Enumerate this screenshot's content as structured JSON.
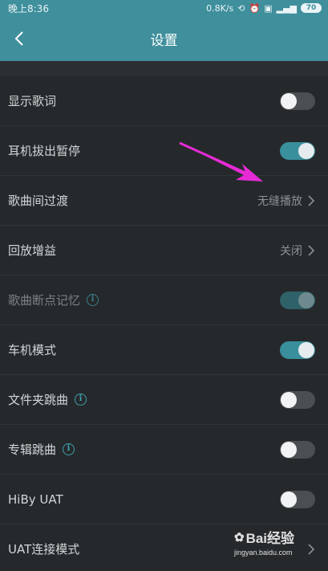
{
  "status_bar": {
    "time": "晚上8:36",
    "network_speed": "0.8K/s",
    "battery": "70"
  },
  "header": {
    "title": "设置"
  },
  "settings": [
    {
      "label": "显示歌词",
      "control": "toggle",
      "state": "off"
    },
    {
      "label": "耳机拔出暂停",
      "control": "toggle",
      "state": "on"
    },
    {
      "label": "歌曲间过渡",
      "control": "value",
      "value": "无缝播放"
    },
    {
      "label": "回放增益",
      "control": "value",
      "value": "关闭"
    },
    {
      "label": "歌曲断点记忆",
      "control": "toggle",
      "state": "on",
      "disabled": true,
      "info": true
    },
    {
      "label": "车机模式",
      "control": "toggle",
      "state": "on"
    },
    {
      "label": "文件夹跳曲",
      "control": "toggle",
      "state": "off",
      "info": true
    },
    {
      "label": "专辑跳曲",
      "control": "toggle",
      "state": "off",
      "info": true
    },
    {
      "label": "HiBy UAT",
      "control": "toggle",
      "state": "off"
    },
    {
      "label": "UAT连接模式",
      "control": "value",
      "value": ""
    }
  ],
  "watermark": {
    "brand": "Bai经验",
    "url": "jingyan.baidu.com"
  },
  "colors": {
    "accent": "#3f8f9c",
    "background": "#25292b",
    "annotation_arrow": "#e62bd6"
  },
  "icons": {
    "back": "chevron-left-icon",
    "info": "info-icon",
    "chevron": "chevron-right-icon"
  }
}
